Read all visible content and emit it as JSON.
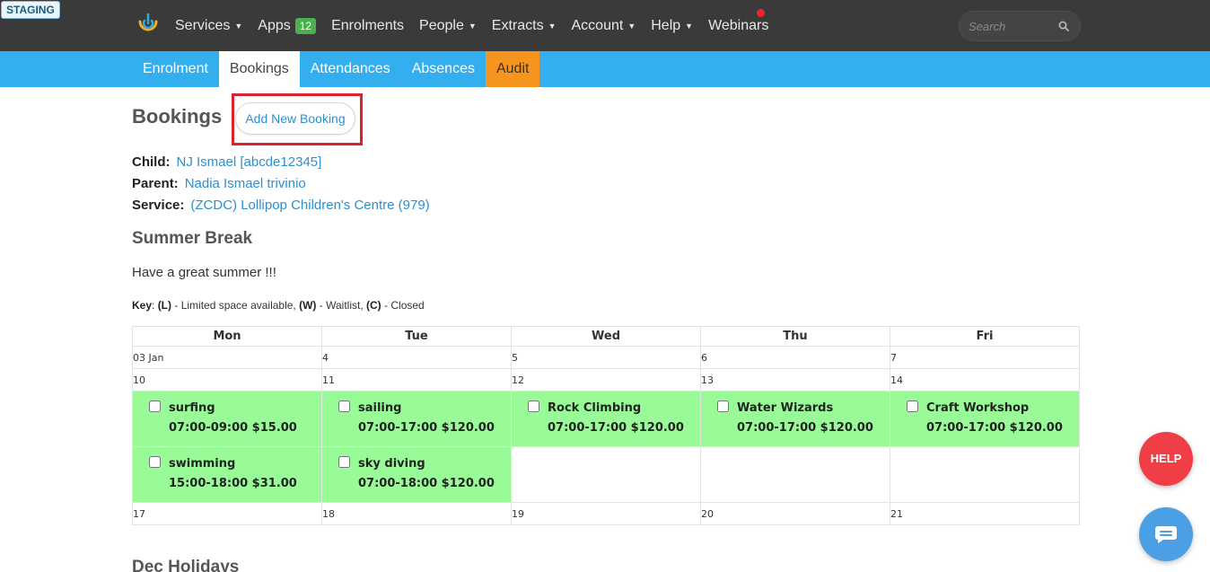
{
  "env_badge": "STAGING",
  "nav": {
    "items": [
      {
        "label": "Services",
        "dropdown": true
      },
      {
        "label": "Apps",
        "badge": "12"
      },
      {
        "label": "Enrolments"
      },
      {
        "label": "People",
        "dropdown": true
      },
      {
        "label": "Extracts",
        "dropdown": true
      },
      {
        "label": "Account",
        "dropdown": true
      },
      {
        "label": "Help",
        "dropdown": true
      },
      {
        "label": "Webinars"
      }
    ],
    "caret": "▼",
    "search_placeholder": "Search",
    "colors": {
      "bar": "#3a3a3a",
      "badge": "#4cb050",
      "notification": "#f0252b"
    }
  },
  "subnav": {
    "tabs": [
      "Enrolment",
      "Bookings",
      "Attendances",
      "Absences",
      "Audit"
    ],
    "active": "Bookings",
    "colors": {
      "bar": "#33aeef",
      "audit": "#f7941d"
    }
  },
  "page": {
    "title": "Bookings",
    "add_button": "Add New Booking",
    "child_label": "Child:",
    "child_value": "NJ Ismael [abcde12345]",
    "parent_label": "Parent:",
    "parent_value": "Nadia Ismael trivinio",
    "service_label": "Service:",
    "service_value": "(ZCDC) Lollipop Children's Centre (979)"
  },
  "section": {
    "title": "Summer Break",
    "description": "Have a great summer !!!",
    "key": {
      "label": "Key",
      "l_code": "(L)",
      "l_text": "- Limited space available,",
      "w_code": "(W)",
      "w_text": "- Waitlist,",
      "c_code": "(C)",
      "c_text": "- Closed"
    }
  },
  "calendar": {
    "days": [
      "Mon",
      "Tue",
      "Wed",
      "Thu",
      "Fri"
    ],
    "week1": [
      "03 Jan",
      "4",
      "5",
      "6",
      "7"
    ],
    "week2": [
      "10",
      "11",
      "12",
      "13",
      "14"
    ],
    "week3": [
      "17",
      "18",
      "19",
      "20",
      "21"
    ],
    "bookings_row1": [
      {
        "name": "surfing",
        "details": "07:00-09:00 $15.00"
      },
      {
        "name": "sailing",
        "details": "07:00-17:00 $120.00"
      },
      {
        "name": "Rock Climbing",
        "details": "07:00-17:00 $120.00"
      },
      {
        "name": "Water Wizards",
        "details": "07:00-17:00 $120.00"
      },
      {
        "name": "Craft Workshop",
        "details": "07:00-17:00 $120.00"
      }
    ],
    "bookings_row2": [
      {
        "name": "swimming",
        "details": "15:00-18:00 $31.00"
      },
      {
        "name": "sky diving",
        "details": "07:00-18:00 $120.00"
      }
    ],
    "booked_color": "#98fb98"
  },
  "next_section_title": "Dec Holidays",
  "help_button": "HELP"
}
